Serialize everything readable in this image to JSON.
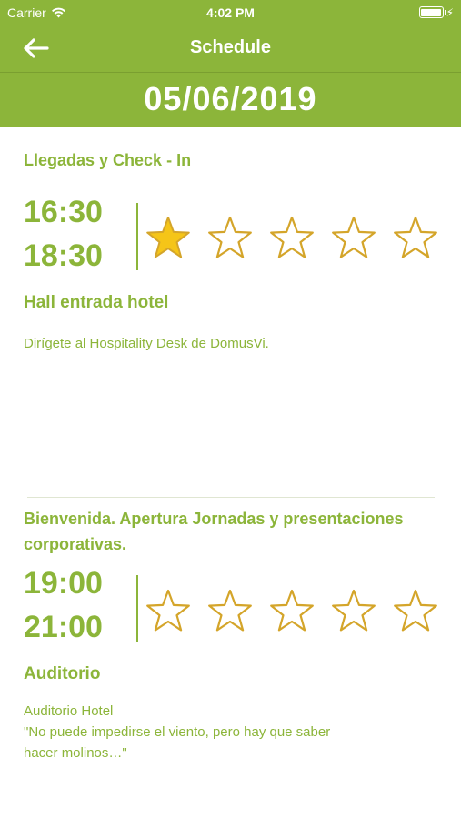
{
  "status": {
    "carrier": "Carrier",
    "time": "4:02 PM"
  },
  "nav": {
    "title": "Schedule"
  },
  "date": "05/06/2019",
  "colors": {
    "accent": "#8cb53a",
    "star_fill": "#f5c518",
    "star_outline": "#d4a52a"
  },
  "events": [
    {
      "title": "Llegadas y Check - In",
      "start": "16:30",
      "end": "18:30",
      "rating": 1,
      "location": "Hall entrada hotel",
      "description": [
        "Dirígete al Hospitality Desk de DomusVi."
      ]
    },
    {
      "title": "Bienvenida. Apertura Jornadas y presentaciones corporativas.",
      "start": "19:00",
      "end": "21:00",
      "rating": 0,
      "location": "Auditorio",
      "description": [
        "Auditorio Hotel",
        "\"No puede impedirse el viento, pero hay que saber",
        "hacer molinos…\""
      ]
    }
  ]
}
